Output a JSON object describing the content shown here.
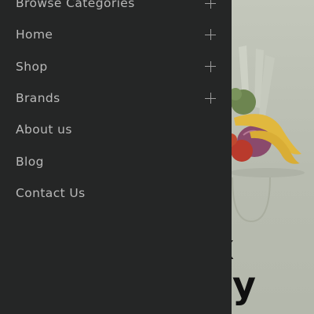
{
  "menu": {
    "items": [
      {
        "label": "Browse Categories",
        "has_submenu": true,
        "icon": "plus-icon"
      },
      {
        "label": "Home",
        "has_submenu": true,
        "icon": "plus-icon"
      },
      {
        "label": "Shop",
        "has_submenu": true,
        "icon": "plus-icon"
      },
      {
        "label": "Brands",
        "has_submenu": true,
        "icon": "plus-icon"
      },
      {
        "label": "About us",
        "has_submenu": false
      },
      {
        "label": "Blog",
        "has_submenu": false
      },
      {
        "label": "Contact Us",
        "has_submenu": false
      }
    ]
  },
  "hero": {
    "line1": "x",
    "line2": "y"
  },
  "colors": {
    "drawer_bg": "#252626",
    "menu_text": "#b9b9b9",
    "page_bg": "#b9bdb1"
  }
}
